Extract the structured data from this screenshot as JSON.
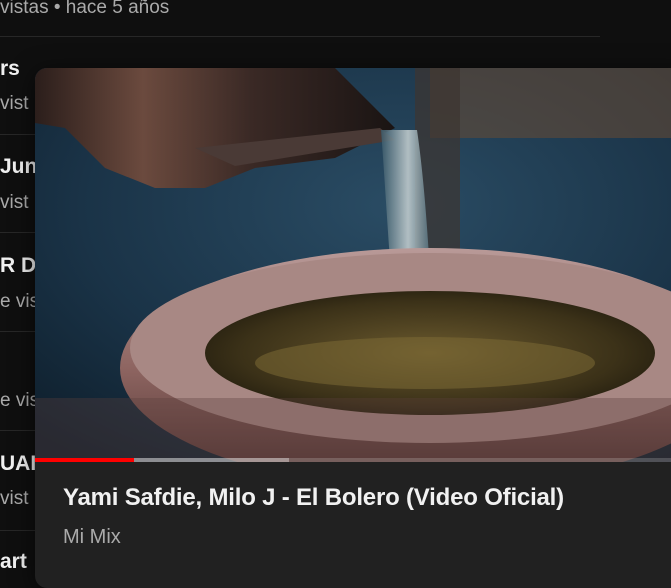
{
  "background_list": {
    "top_meta": "vistas • hace 5 años",
    "rows": [
      {
        "title": "rs",
        "meta": "vist"
      },
      {
        "title": "Jun",
        "meta": "vist"
      },
      {
        "title": "R D",
        "meta": "e vis"
      },
      {
        "title": "",
        "meta": "e vis"
      },
      {
        "title": "UAI",
        "meta": "vist"
      },
      {
        "title": "art",
        "meta": ""
      }
    ]
  },
  "preview_card": {
    "title": "Yami Safdie, Milo J - El Bolero (Video Oficial)",
    "channel": "Mi Mix",
    "progress_fraction": 0.15,
    "buffer_fraction": 0.385
  },
  "colors": {
    "background": "#0f0f0f",
    "card": "#212121",
    "progress": "#ff0000",
    "meta_text": "#aaaaaa"
  }
}
